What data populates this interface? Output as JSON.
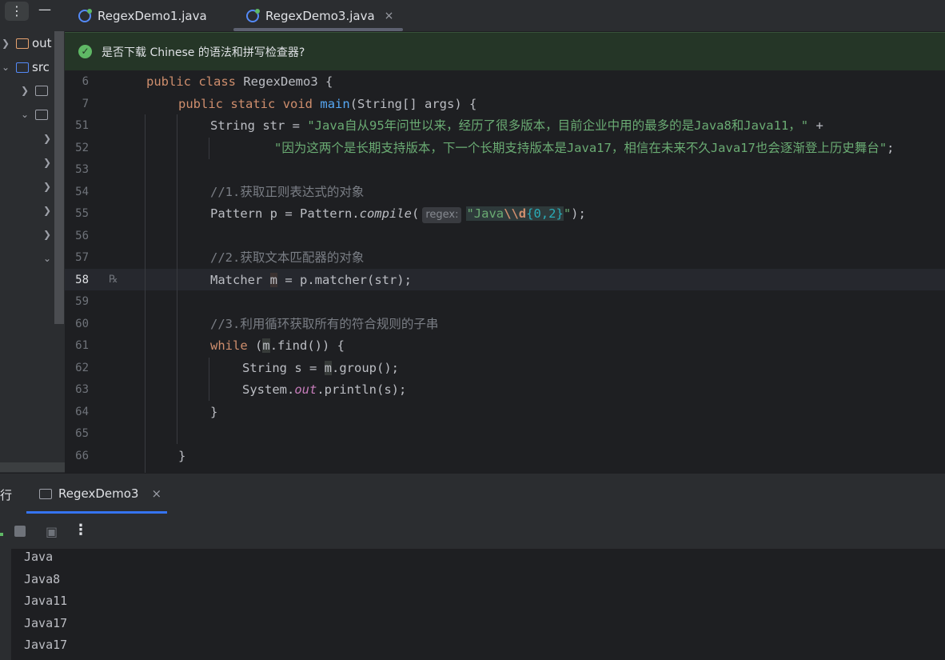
{
  "tabs": [
    {
      "label": "RegexDemo1.java"
    },
    {
      "label": "RegexDemo3.java",
      "close": "×"
    }
  ],
  "toolbar": {
    "menu_glyph": "⋮",
    "minimize_glyph": "—"
  },
  "sidebar": {
    "items": [
      {
        "label": "out"
      },
      {
        "label": "src"
      }
    ]
  },
  "banner": {
    "text": "是否下载 Chinese 的语法和拼写检查器?"
  },
  "editor": {
    "line_numbers": [
      "6",
      "7",
      "51",
      "52",
      "53",
      "54",
      "55",
      "56",
      "57",
      "58",
      "59",
      "60",
      "61",
      "62",
      "63",
      "64",
      "65",
      "66"
    ],
    "hint_regex": "regex:",
    "current_line": "58"
  },
  "code": {
    "l6_a": "public",
    "l6_b": "class",
    "l6_c": " RegexDemo3 {",
    "l7_a": "public",
    "l7_b": "static",
    "l7_c": "void",
    "l7_fn": "main",
    "l7_d": "(String[] args) {",
    "l51_a": "String str = ",
    "l51_str": "\"Java自从95年问世以来，经历了很多版本，目前企业中用的最多的是Java8和Java11，\"",
    "l51_b": " +",
    "l52_str": "\"因为这两个是长期支持版本，下一个长期支持版本是Java17，相信在未来不久Java17也会逐渐登上历史舞台\"",
    "l52_b": ";",
    "l54_cmt": "//1.获取正则表达式的对象",
    "l55_a": "Pattern p = Pattern.",
    "l55_it": "compile",
    "l55_b": "(",
    "l55_q1": "\"Java",
    "l55_esc": "\\\\d",
    "l55_rx": "{0,2}",
    "l55_q2": "\"",
    "l55_c": ");",
    "l57_cmt": "//2.获取文本匹配器的对象",
    "l58_a": "Matcher ",
    "l58_m": "m",
    "l58_b": " = p.matcher(str);",
    "l60_cmt": "//3.利用循环获取所有的符合规则的子串",
    "l61_kw": "while",
    "l61_a": " (",
    "l61_m": "m",
    "l61_b": ".find()) {",
    "l62_a": "String s = ",
    "l62_m": "m",
    "l62_b": ".group();",
    "l63_a": "System.",
    "l63_out": "out",
    "l63_b": ".println(s);",
    "l64": "}",
    "l66": "}"
  },
  "run_panel": {
    "label": "行",
    "tab_label": "RegexDemo3",
    "tab_close": "×",
    "more_glyph": "⋮",
    "output": [
      "Java",
      "Java8",
      "Java11",
      "Java17",
      "Java17"
    ]
  }
}
